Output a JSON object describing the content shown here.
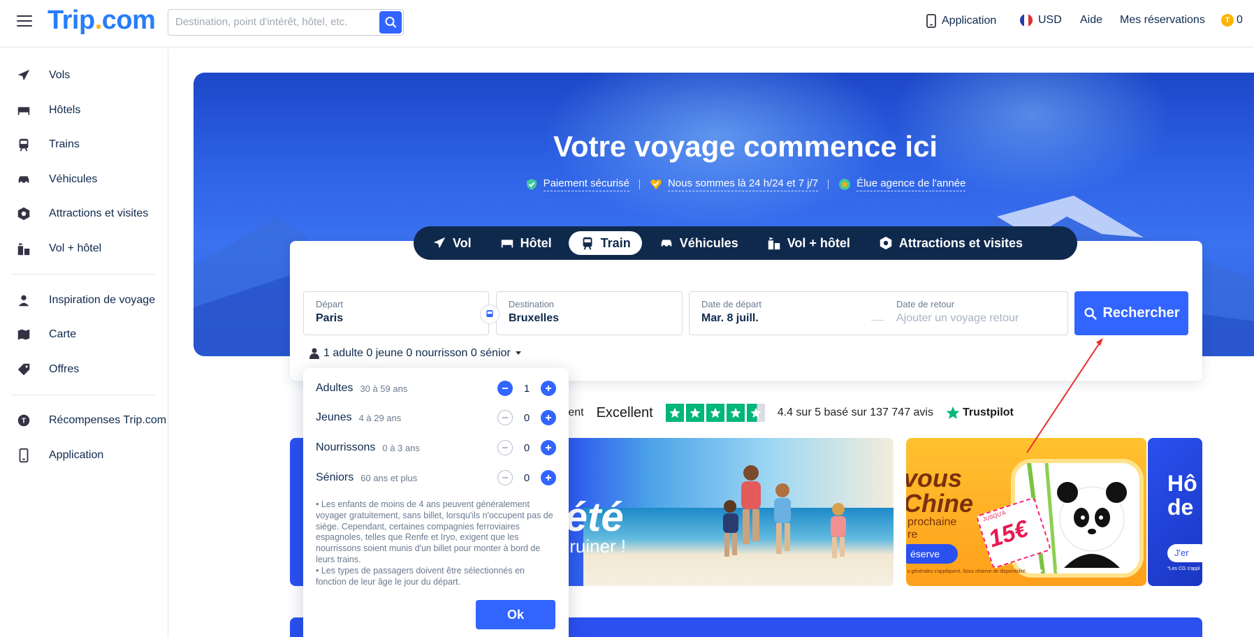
{
  "header": {
    "logo_main": "Trip",
    "logo_dot": ".",
    "logo_tail": "com",
    "search_placeholder": "Destination, point d'intérêt, hôtel, etc.",
    "app_label": "Application",
    "currency": "USD",
    "help": "Aide",
    "reservations": "Mes réservations",
    "coins": "0"
  },
  "sidebar": {
    "items": [
      {
        "label": "Vols",
        "icon": "plane-icon"
      },
      {
        "label": "Hôtels",
        "icon": "bed-icon"
      },
      {
        "label": "Trains",
        "icon": "train-icon"
      },
      {
        "label": "Véhicules",
        "icon": "car-icon"
      },
      {
        "label": "Attractions et visites",
        "icon": "attraction-icon"
      },
      {
        "label": "Vol + hôtel",
        "icon": "flight-hotel-icon"
      },
      {
        "label": "Inspiration de voyage",
        "icon": "pin-person-icon"
      },
      {
        "label": "Carte",
        "icon": "map-icon"
      },
      {
        "label": "Offres",
        "icon": "tag-icon"
      },
      {
        "label": "Récompenses Trip.com",
        "icon": "trip-coin-icon"
      },
      {
        "label": "Application",
        "icon": "phone-icon"
      }
    ]
  },
  "hero": {
    "title": "Votre voyage commence ici",
    "badges": [
      "Paiement sécurisé",
      "Nous sommes là 24 h/24 et 7 j/7",
      "Élue agence de l'année"
    ]
  },
  "tabs": [
    {
      "label": "Vol",
      "active": false
    },
    {
      "label": "Hôtel",
      "active": false
    },
    {
      "label": "Train",
      "active": true
    },
    {
      "label": "Véhicules",
      "active": false
    },
    {
      "label": "Vol + hôtel",
      "active": false
    },
    {
      "label": "Attractions et visites",
      "active": false
    }
  ],
  "search_form": {
    "depart_label": "Départ",
    "depart_value": "Paris",
    "destination_label": "Destination",
    "destination_value": "Bruxelles",
    "date_depart_label": "Date de départ",
    "date_depart_value": "Mar. 8 juill.",
    "date_return_label": "Date de retour",
    "date_return_placeholder": "Ajouter un voyage retour",
    "search_button": "Rechercher",
    "passengers_summary": "1 adulte 0 jeune 0 nourrisson 0 sénior"
  },
  "passenger_popup": {
    "rows": [
      {
        "name": "Adultes",
        "age": "30 à 59 ans",
        "count": "1"
      },
      {
        "name": "Jeunes",
        "age": "4 à 29 ans",
        "count": "0"
      },
      {
        "name": "Nourrissons",
        "age": "0 à 3 ans",
        "count": "0"
      },
      {
        "name": "Séniors",
        "age": "60 ans et plus",
        "count": "0"
      }
    ],
    "note_1": "• Les enfants de moins de 4 ans peuvent généralement voyager gratuitement, sans billet, lorsqu'ils n'occupent pas de siège. Cependant, certaines compagnies ferroviaires espagnoles, telles que Renfe et Iryo, exigent que les nourrissons soient munis d'un billet pour monter à bord de leurs trains.",
    "note_2": "• Les types de passagers doivent être sélectionnés en fonction de leur âge le jour du départ.",
    "ok": "Ok"
  },
  "trustpilot": {
    "partial": "ment",
    "rating_word": "Excellent",
    "rating_value": 4.4,
    "summary": "4.4 sur 5 basé sur 137 747 avis",
    "brand": "Trustpilot"
  },
  "promos": {
    "summer_big": "'été",
    "summer_small": "s ruiner !",
    "china_title_1": "vous",
    "china_title_2": "Chine",
    "china_sub_1": "prochaine",
    "china_sub_2": "re",
    "china_button": "éserve",
    "china_fine": "s générales s'appliquent. Sous réserve de disponibilité.",
    "ticket_top": "JUSQU'À",
    "ticket_value": "15€",
    "hotel_title_1": "Hô",
    "hotel_title_2": "de",
    "hotel_button": "J'er",
    "hotel_fine": "*Les CG s'appl"
  },
  "colors": {
    "brand_blue": "#287dfa",
    "accent_blue": "#3264ff",
    "navy": "#0f294d",
    "trustpilot_green": "#00b67a"
  }
}
